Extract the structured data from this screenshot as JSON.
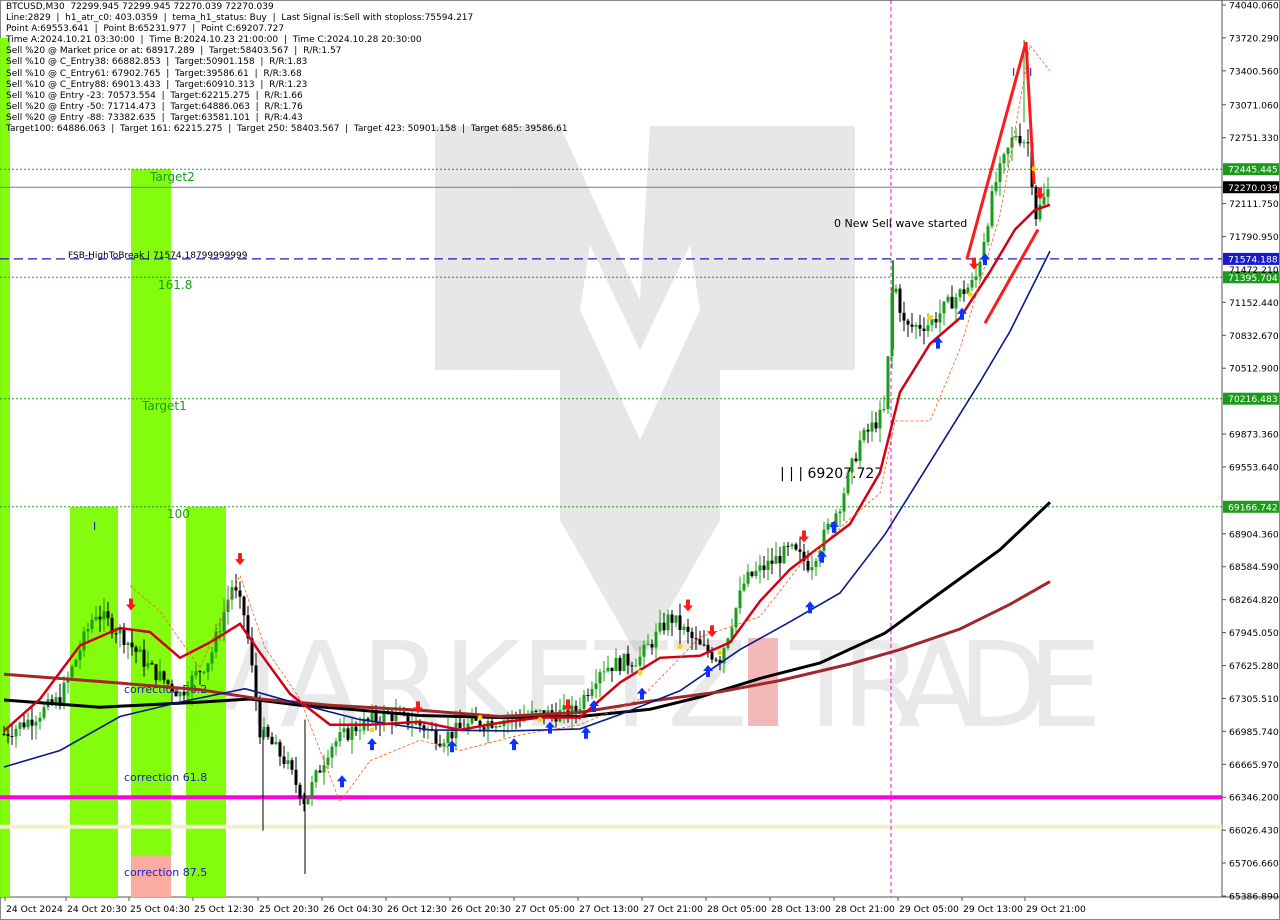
{
  "header_lines": [
    "BTCUSD,M30  72299.945 72299.945 72270.039 72270.039",
    "Line:2829  |  h1_atr_c0: 403.0359  |  tema_h1_status: Buy  |  Last Signal is:Sell with stoploss:75594.217",
    "Point A:69553.641  |  Point B:65231.977  |  Point C:69207.727",
    "Time A:2024.10.21 03:30:00  |  Time B:2024.10.23 21:00:00  |  Time C:2024.10.28 20:30:00",
    "Sell %20 @ Market price or at: 68917.289  |  Target:58403.567  |  R/R:1.57",
    "Sell %10 @ C_Entry38: 66882.853  |  Target:50901.158  |  R/R:1.83",
    "Sell %10 @ C_Entry61: 67902.765  |  Target:39586.61  |  R/R:3.68",
    "Sell %10 @ C_Entry88: 69013.433  |  Target:60910.313  |  R/R:1.23",
    "Sell %10 @ Entry -23: 70573.554  |  Target:62215.275  |  R/R:1.66",
    "Sell %20 @ Entry -50: 71714.473  |  Target:64886.063  |  R/R:1.76",
    "Sell %20 @ Entry -88: 73382.635  |  Target:63581.101  |  R/R:4.43",
    "Target100: 64886.063  |  Target 161: 62215.275  |  Target 250: 58403.567  |  Target 423: 50901.158  |  Target 685: 39586.61"
  ],
  "chart_data": {
    "type": "candlestick",
    "symbol": "BTCUSD",
    "timeframe": "M30",
    "ylim": [
      65386.89,
      74040.06
    ],
    "y_ticks": [
      74040.06,
      73720.29,
      73400.56,
      73071.06,
      72751.33,
      72111.75,
      71790.95,
      71152.44,
      70832.67,
      70512.9,
      69873.36,
      69553.64,
      68904.36,
      68584.59,
      68264.82,
      67945.05,
      67625.28,
      67305.51,
      66985.74,
      66665.97,
      66346.2,
      66026.43,
      65706.66,
      65386.89
    ],
    "x_labels": [
      "24 Oct 2024",
      "24 Oct 20:30",
      "25 Oct 04:30",
      "25 Oct 12:30",
      "25 Oct 20:30",
      "26 Oct 04:30",
      "26 Oct 12:30",
      "26 Oct 20:30",
      "27 Oct 05:00",
      "27 Oct 13:00",
      "27 Oct 21:00",
      "28 Oct 05:00",
      "28 Oct 13:00",
      "28 Oct 21:00",
      "29 Oct 05:00",
      "29 Oct 13:00",
      "29 Oct 21:00"
    ],
    "current_price": 72270.039,
    "price_tags": [
      {
        "value": 72445.445,
        "label": "72445.445",
        "color": "#1a9c1a"
      },
      {
        "value": 72270.039,
        "label": "72270.039",
        "color": "#000000"
      },
      {
        "value": 71574.188,
        "label": "71574.188",
        "color": "#1a1acc"
      },
      {
        "value": 71395.704,
        "label": "71395.704",
        "color": "#1a9c1a"
      },
      {
        "value": 70216.483,
        "label": "70216.483",
        "color": "#1a9c1a"
      },
      {
        "value": 69166.742,
        "label": "69166.742",
        "color": "#1a9c1a"
      }
    ],
    "hidden_tag": "71472.210",
    "levels": [
      {
        "value": 72445.445,
        "style": "dotted",
        "color": "#1a9c1a"
      },
      {
        "value": 72270.039,
        "style": "solid",
        "color": "#6f7a99"
      },
      {
        "value": 71574.188,
        "style": "dashed",
        "color": "#1a1acc"
      },
      {
        "value": 71395.704,
        "style": "dotted",
        "color": "#1a9c1a"
      },
      {
        "value": 70216.483,
        "style": "dotted",
        "color": "#1a9c1a"
      },
      {
        "value": 69166.742,
        "style": "dotted",
        "color": "#1a9c1a"
      },
      {
        "value": 66346.2,
        "style": "solid",
        "color": "#ff00dd"
      },
      {
        "value": 66060.0,
        "style": "solid",
        "color": "#f2f0cc"
      }
    ],
    "zone_labels": {
      "target2": "Target2",
      "fib161": "161.8",
      "target1": "Target1",
      "fib100": "100",
      "corr38": "correction 38.2",
      "corr61": "correction 61.8",
      "corr87": "correction 87.5",
      "fsb": "FSB-HighToBreak | 71574.18799999999",
      "new_wave": "0 New Sell wave started",
      "point_c": "| | | 69207.727",
      "marker_a": "I",
      "marker_b": "I",
      "marker_c": "I"
    },
    "watermark": "MARKETZITRADE",
    "colors": {
      "bull": "#1a9c1a",
      "bear": "#000000",
      "band_green": "#7cfc00",
      "band_red": "#ffa8a8",
      "ema_red": "#d10015",
      "ema_blue": "#0a1a8a",
      "ma_black": "#000000",
      "ma_brown": "#a0282b",
      "magenta": "#ff00dd",
      "arrow_up": "#1030ff",
      "arrow_down": "#ff1a1a",
      "label_green": "#1a9c1a",
      "label_blue": "#1a1acc"
    }
  }
}
